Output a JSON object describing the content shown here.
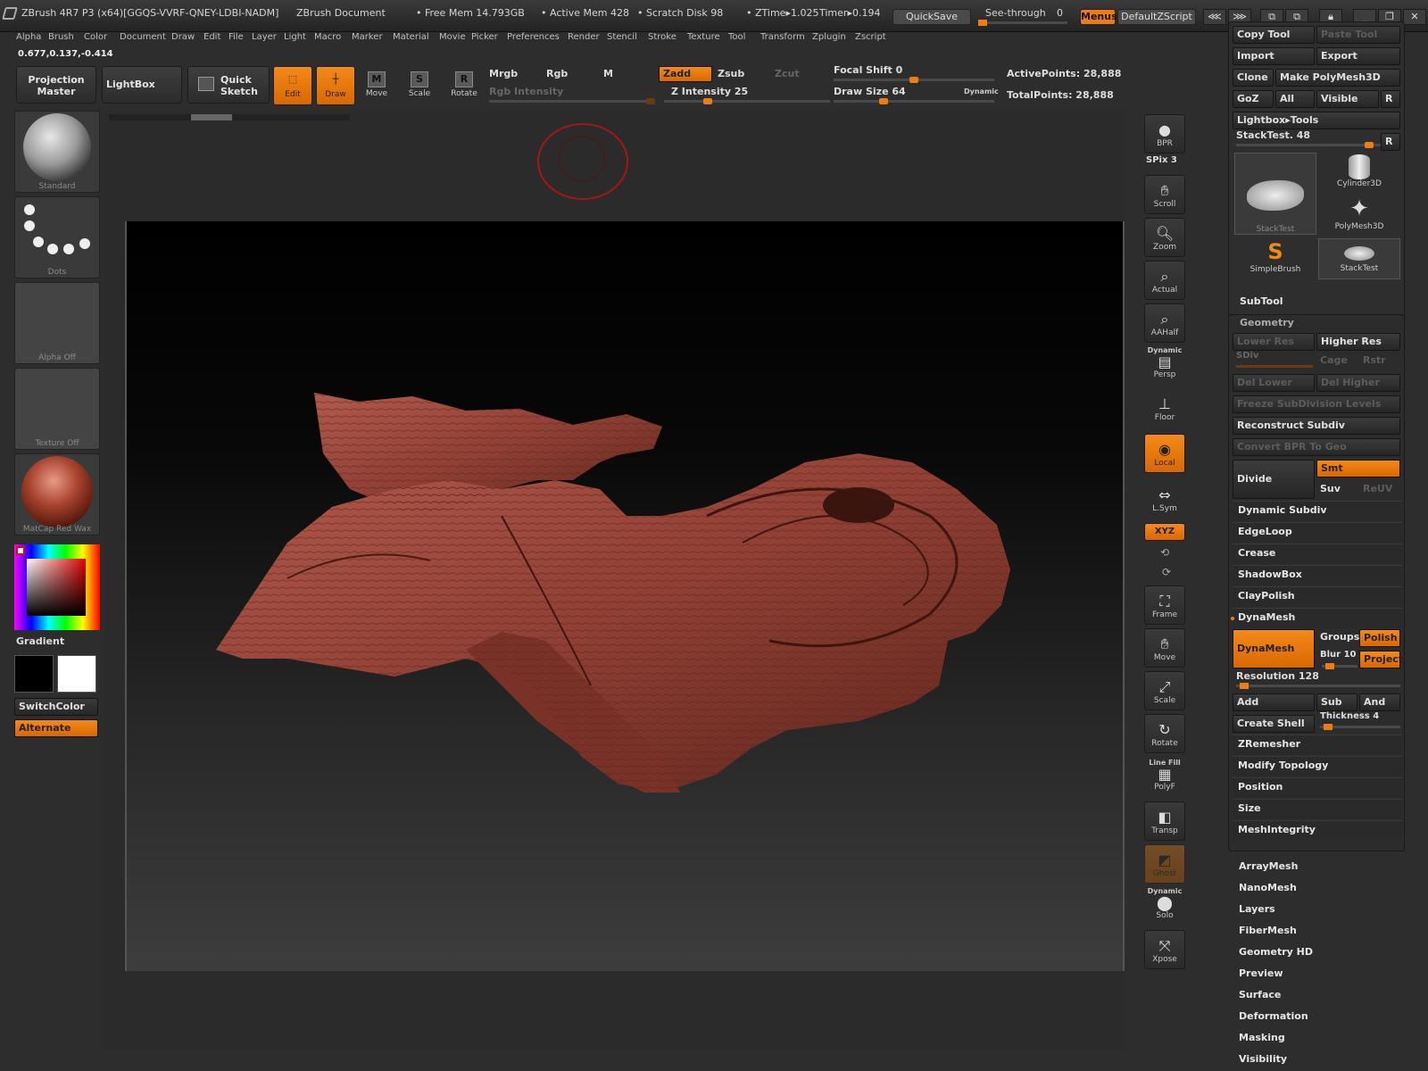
{
  "titlebar": {
    "app_title": "ZBrush 4R7 P3 (x64)[GGQS-VVRF-QNEY-LDBI-NADM]",
    "doc_title": "ZBrush Document",
    "free_mem": "• Free Mem 14.793GB",
    "active_mem": "• Active Mem 428",
    "scratch": "• Scratch Disk 98",
    "ztime": "• ZTime▸1.025",
    "timer": "Timer▸0.194",
    "quicksave": "QuickSave",
    "seethrough": "See-through",
    "seethrough_value": "0",
    "menus": "Menus",
    "script": "DefaultZScript"
  },
  "menubar": [
    "Alpha",
    "Brush",
    "Color",
    "Document",
    "Draw",
    "Edit",
    "File",
    "Layer",
    "Light",
    "Macro",
    "Marker",
    "Material",
    "Movie",
    "Picker",
    "Preferences",
    "Render",
    "Stencil",
    "Stroke",
    "Texture",
    "Tool",
    "Transform",
    "Zplugin",
    "Zscript"
  ],
  "coords": "0.677,0.137,-0.414",
  "shelf": {
    "projection_master": "Projection Master",
    "lightbox": "LightBox",
    "quick_sketch": "Quick Sketch",
    "edit": "Edit",
    "draw": "Draw",
    "move": "Move",
    "scale": "Scale",
    "rotate": "Rotate",
    "mrgb": "Mrgb",
    "rgb": "Rgb",
    "m": "M",
    "zadd": "Zadd",
    "zsub": "Zsub",
    "zcut": "Zcut",
    "rgb_intensity": "Rgb Intensity",
    "z_intensity": "Z Intensity 25",
    "focal_shift": "Focal Shift 0",
    "draw_size": "Draw Size 64",
    "dynamic": "Dynamic",
    "active_points": "ActivePoints: 28,888",
    "total_points": "TotalPoints: 28,888",
    "z_intensity_level": 0.25,
    "focal_shift_level": 0.5,
    "draw_size_level": 0.3
  },
  "left": {
    "standard": "Standard",
    "dots": "Dots",
    "alpha": "Alpha Off",
    "texture": "Texture Off",
    "matcap": "MatCap Red Wax",
    "gradient": "Gradient",
    "switch_color": "SwitchColor",
    "alternate": "Alternate"
  },
  "right_shelf": {
    "bpr": "BPR",
    "spix": "SPix 3",
    "scroll": "Scroll",
    "zoom": "Zoom",
    "actual": "Actual",
    "aahalf": "AAHalf",
    "dynamic": "Dynamic",
    "persp": "Persp",
    "floor": "Floor",
    "local": "Local",
    "lsym": "L.Sym",
    "xyz": "XYZ",
    "frame": "Frame",
    "move": "Move",
    "scale": "Scale",
    "rotate": "Rotate",
    "line_fill": "Line Fill",
    "polyf": "PolyF",
    "transp": "Transp",
    "ghost": "Ghost",
    "dynamic2": "Dynamic",
    "solo": "Solo",
    "xpose": "Xpose"
  },
  "tool_panel": {
    "copy_tool": "Copy Tool",
    "paste_tool": "Paste Tool",
    "import": "Import",
    "export": "Export",
    "clone": "Clone",
    "make_polymesh": "Make PolyMesh3D",
    "goz": "GoZ",
    "all": "All",
    "visible": "Visible",
    "r": "R",
    "lightbox_tools": "Lightbox▸Tools",
    "stacktest": "StackTest. 48",
    "stacktest_level": 0.95,
    "tools": [
      "StackTest",
      "Cylinder3D",
      "PolyMesh3D",
      "SimpleBrush",
      "StackTest"
    ],
    "subtool": "SubTool",
    "geometry": "Geometry",
    "lower_res": "Lower Res",
    "higher_res": "Higher Res",
    "sdiv": "SDiv",
    "cage": "Cage",
    "rstr": "Rstr",
    "del_lower": "Del Lower",
    "del_higher": "Del Higher",
    "freeze": "Freeze SubDivision Levels",
    "reconstruct": "Reconstruct Subdiv",
    "convert_bpr": "Convert BPR To Geo",
    "divide": "Divide",
    "smt": "Smt",
    "suv": "Suv",
    "reuv": "ReUV",
    "dynamic_subdiv": "Dynamic Subdiv",
    "edgeloop": "EdgeLoop",
    "crease": "Crease",
    "shadowbox": "ShadowBox",
    "claypolish": "ClayPolish",
    "dynamesh_hdr": "DynaMesh",
    "dynamesh_btn": "DynaMesh",
    "groups": "Groups",
    "polish": "Polish",
    "blur": "Blur 10",
    "project": "Project",
    "resolution": "Resolution 128",
    "add": "Add",
    "sub": "Sub",
    "and": "And",
    "create_shell": "Create Shell",
    "thickness": "Thickness 4",
    "zremesher": "ZRemesher",
    "modify_topology": "Modify Topology",
    "position": "Position",
    "size": "Size",
    "meshintegrity": "MeshIntegrity"
  },
  "subpanels": [
    "ArrayMesh",
    "NanoMesh",
    "Layers",
    "FiberMesh",
    "Geometry HD",
    "Preview",
    "Surface",
    "Deformation",
    "Masking",
    "Visibility"
  ],
  "colors": {
    "accent": "#ef7c10",
    "model": "#9c4a40",
    "bg": "#2d2d2d"
  }
}
